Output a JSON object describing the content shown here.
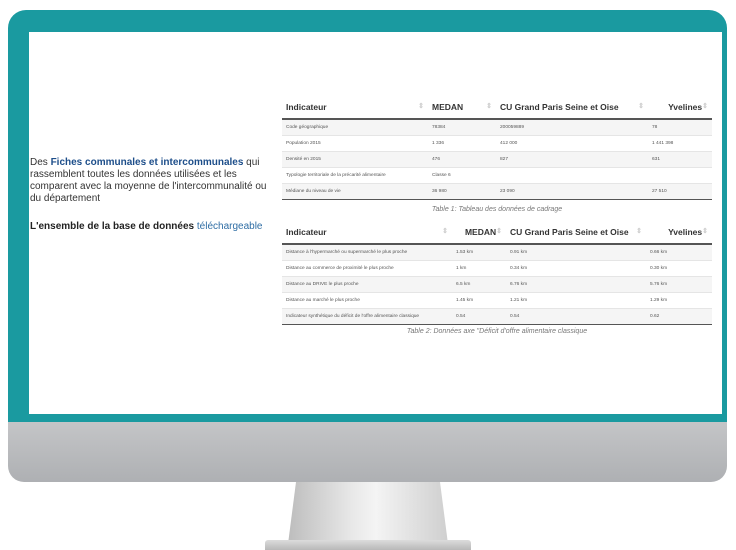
{
  "sidebar_text": {
    "line_prefix": "Des ",
    "highlight": "Fiches communales et intercommunales",
    "body": " qui rassemblent toutes les données utilisées et les comparent avec la moyenne de l'intercommunalité ou du département",
    "db_title": "L'ensemble de la base de données",
    "db_link": "téléchargeable"
  },
  "table1": {
    "headers": [
      "Indicateur",
      "MEDAN",
      "CU Grand Paris Seine et Oise",
      "Yvelines"
    ],
    "rows": [
      [
        "Code géographique",
        "78384",
        "200059889",
        "78"
      ],
      [
        "Population 2015",
        "1 336",
        "412 000",
        "1 441 398"
      ],
      [
        "Densité en 2015",
        "476",
        "827",
        "631"
      ],
      [
        "Typologie territoriale de la précarité alimentaire",
        "Classe 6",
        "",
        ""
      ],
      [
        "Médiane du niveau de vie",
        "36 980",
        "23 090",
        "27 510"
      ]
    ],
    "caption": "Table 1: Tableau des données de cadrage"
  },
  "table2": {
    "headers": [
      "Indicateur",
      "MEDAN",
      "CU Grand Paris Seine et Oise",
      "Yvelines"
    ],
    "rows": [
      [
        "Distance à l'hypermarché ou supermarché le plus proche",
        "1.53 km",
        "0.91 km",
        "0.66 km"
      ],
      [
        "Distance au commerce de proximité le plus proche",
        "1 km",
        "0.34 km",
        "0.30 km"
      ],
      [
        "Distance au DRIVE le plus proche",
        "6.5 km",
        "6.76 km",
        "5.76 km"
      ],
      [
        "Distance au marché le plus proche",
        "1.45 km",
        "1.21 km",
        "1.29 km"
      ],
      [
        "Indicateur synthétique du déficit de l'offre alimentaire classique",
        "0.54",
        "0.54",
        "0.62"
      ]
    ],
    "caption": "Table 2: Données axe \"Déficit d'offre alimentaire classique"
  }
}
